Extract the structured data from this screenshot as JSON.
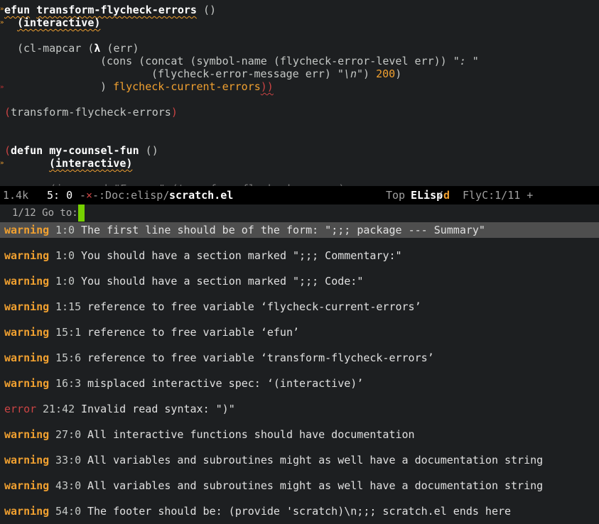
{
  "editor": {
    "l1_defun": "efun",
    "l1_name": "transform-flycheck-errors",
    "l1_args": " ()",
    "l2": "(interactive)",
    "l4_a": "(cl-mapcar (",
    "l4_lambda": "λ",
    "l4_b": " (err)",
    "l5_a": "(cons (concat (symbol-name (flycheck-error-level err)) ",
    "l5_str": "\": \"",
    "l6_a": "(flycheck-error-message err) ",
    "l6_str": "\"\\n\"",
    "l6_b": ") ",
    "l6_num": "200",
    "l6_c": ")",
    "l7_a": ") ",
    "l7_var": "flycheck-current-errors",
    "l7_b": "))",
    "l9_open": "(",
    "l9_text": "transform-flycheck-errors",
    "l9_close": ")",
    "l12_open": "(",
    "l12_kw": "defun",
    "l12_sp": " ",
    "l12_name": "my-counsel-fun",
    "l12_args": " ()",
    "l13": "(interactive)",
    "cut_line": "(ivy-read \"Errors\" (transform-flycheck-errors)"
  },
  "modeline": {
    "size": "1.4k",
    "linecol": "5: 0",
    "status_a": "-",
    "status_x": "×",
    "status_b": "-:Doc:elisp/",
    "buffer": "scratch.el",
    "position": "Top",
    "mode": "ELisp",
    "mode_sep": "/",
    "mode_d": "d",
    "flycheck": "FlyC:1/11 +"
  },
  "minibuffer": {
    "prompt": "1/12 Go to:"
  },
  "errors": [
    {
      "level": "warning",
      "loc": "1:0",
      "msg": "The first line should be of the form: \";;; package --- Summary\""
    },
    {
      "level": "warning",
      "loc": "1:0",
      "msg": "You should have a section marked \";;; Commentary:\""
    },
    {
      "level": "warning",
      "loc": "1:0",
      "msg": "You should have a section marked \";;; Code:\""
    },
    {
      "level": "warning",
      "loc": "1:15",
      "msg": "reference to free variable ‘flycheck-current-errors’"
    },
    {
      "level": "warning",
      "loc": "15:1",
      "msg": "reference to free variable ‘efun’"
    },
    {
      "level": "warning",
      "loc": "15:6",
      "msg": "reference to free variable ‘transform-flycheck-errors’"
    },
    {
      "level": "warning",
      "loc": "16:3",
      "msg": "misplaced interactive spec: ‘(interactive)’"
    },
    {
      "level": "error",
      "loc": "21:42",
      "msg": "Invalid read syntax: \")\""
    },
    {
      "level": "warning",
      "loc": "27:0",
      "msg": "All interactive functions should have documentation"
    },
    {
      "level": "warning",
      "loc": "33:0",
      "msg": "All variables and subroutines might as well have a documentation string"
    },
    {
      "level": "warning",
      "loc": "43:0",
      "msg": "All variables and subroutines might as well have a documentation string"
    },
    {
      "level": "warning",
      "loc": "54:0",
      "msg": "The footer should be: (provide 'scratch)\\n;;; scratch.el ends here"
    }
  ]
}
